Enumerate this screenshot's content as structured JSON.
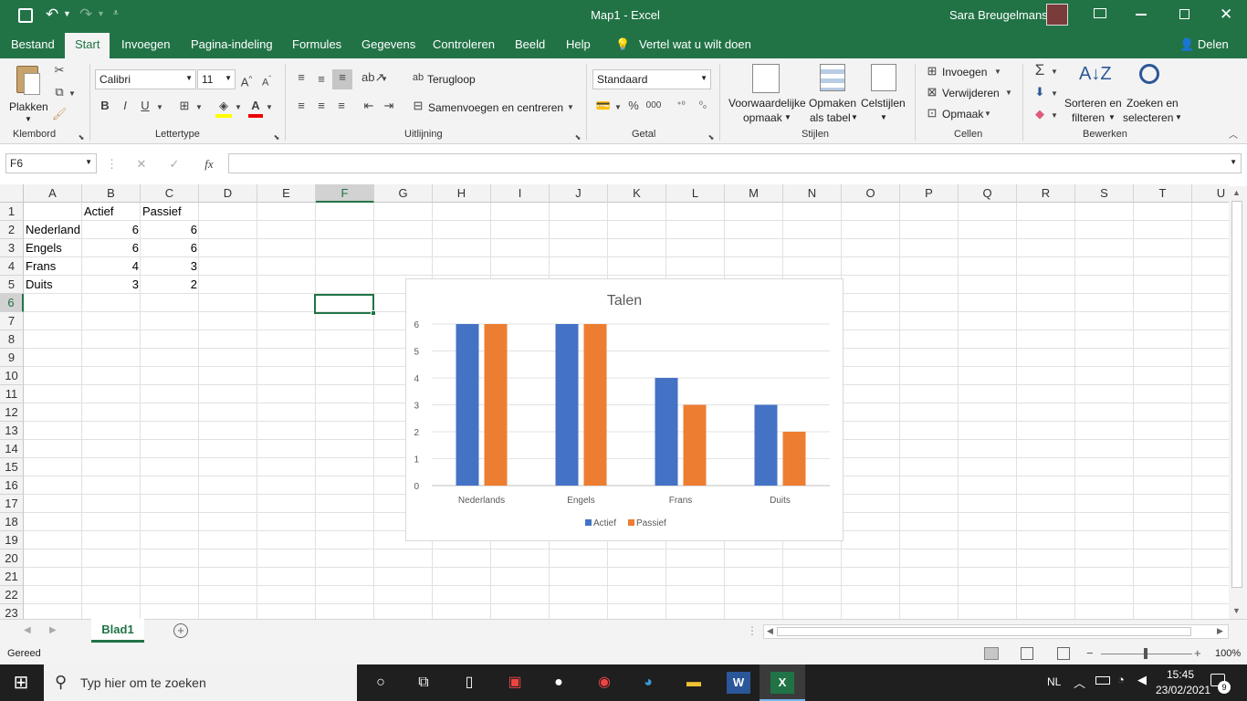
{
  "titlebar": {
    "title": "Map1 - Excel",
    "user": "Sara Breugelmans"
  },
  "ribbon_tabs": [
    "Bestand",
    "Start",
    "Invoegen",
    "Pagina-indeling",
    "Formules",
    "Gegevens",
    "Controleren",
    "Beeld",
    "Help"
  ],
  "tell_me": "Vertel wat u wilt doen",
  "share": "Delen",
  "ribbon": {
    "paste": "Plakken",
    "groups": {
      "clipboard": "Klembord",
      "font": "Lettertype",
      "alignment": "Uitlijning",
      "number": "Getal",
      "styles": "Stijlen",
      "cells": "Cellen",
      "editing": "Bewerken"
    },
    "font_name": "Calibri",
    "font_size": "11",
    "bold": "B",
    "italic": "I",
    "underline": "U",
    "wrap_text": "Terugloop",
    "merge_center": "Samenvoegen en centreren",
    "number_format": "Standaard",
    "conditional_1": "Voorwaardelijke",
    "conditional_2": "opmaak",
    "format_table_1": "Opmaken",
    "format_table_2": "als tabel",
    "cell_styles": "Celstijlen",
    "insert": "Invoegen",
    "delete": "Verwijderen",
    "format": "Opmaak",
    "sort_1": "Sorteren en",
    "sort_2": "filteren",
    "find_1": "Zoeken en",
    "find_2": "selecteren"
  },
  "formula_bar": {
    "name_box": "F6",
    "fx": "fx",
    "formula": ""
  },
  "columns": [
    "A",
    "B",
    "C",
    "D",
    "E",
    "F",
    "G",
    "H",
    "I",
    "J",
    "K",
    "L",
    "M",
    "N",
    "O",
    "P",
    "Q",
    "R",
    "S",
    "T",
    "U"
  ],
  "rows": [
    "1",
    "2",
    "3",
    "4",
    "5",
    "6",
    "7",
    "8",
    "9",
    "10",
    "11",
    "12",
    "13",
    "14",
    "15",
    "16",
    "17",
    "18",
    "19",
    "20",
    "21",
    "22",
    "23"
  ],
  "cells": {
    "B1": "Actief",
    "C1": "Passief",
    "A2": "Nederlands",
    "B2": "6",
    "C2": "6",
    "A3": "Engels",
    "B3": "6",
    "C3": "6",
    "A4": "Frans",
    "B4": "4",
    "C4": "3",
    "A5": "Duits",
    "B5": "3",
    "C5": "2"
  },
  "chart_data": {
    "type": "bar",
    "title": "Talen",
    "categories": [
      "Nederlands",
      "Engels",
      "Frans",
      "Duits"
    ],
    "series": [
      {
        "name": "Actief",
        "values": [
          6,
          6,
          4,
          3
        ],
        "color": "#4472c4"
      },
      {
        "name": "Passief",
        "values": [
          6,
          6,
          3,
          2
        ],
        "color": "#ed7d31"
      }
    ],
    "ylim": [
      0,
      6
    ],
    "yticks": [
      "0",
      "1",
      "2",
      "3",
      "4",
      "5",
      "6"
    ],
    "grid": true,
    "legend": "bottom"
  },
  "sheet_tab": "Blad1",
  "status": {
    "ready": "Gereed",
    "zoom": "100%"
  },
  "taskbar": {
    "search": "Typ hier om te zoeken",
    "lang": "NL",
    "time": "15:45",
    "date": "23/02/2021",
    "notifications": "9"
  },
  "colors": {
    "excel_green": "#217346",
    "actief": "#4472c4",
    "passief": "#ed7d31"
  }
}
